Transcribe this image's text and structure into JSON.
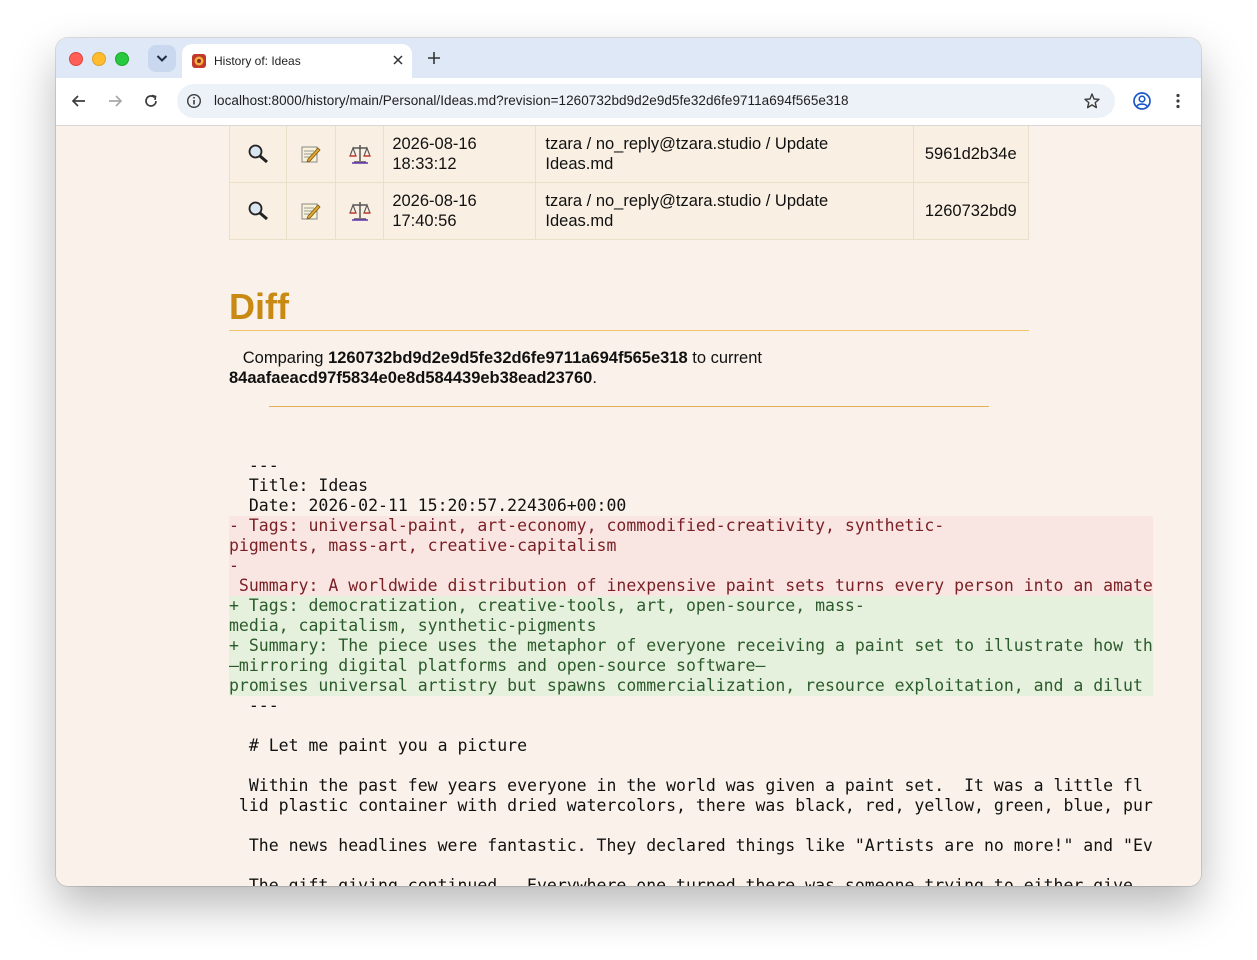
{
  "browser": {
    "tab_title": "History of: Ideas",
    "url": "localhost:8000/history/main/Personal/Ideas.md?revision=1260732bd9d2e9d5fe32d6fe9711a694f565e318"
  },
  "history": {
    "rows": [
      {
        "date": "2026-08-16",
        "time": "18:33:12",
        "msg1": "tzara / no_reply@tzara.studio / Update",
        "msg2": "Ideas.md",
        "hash": "5961d2b34e"
      },
      {
        "date": "2026-08-16",
        "time": "17:40:56",
        "msg1": "tzara / no_reply@tzara.studio / Update",
        "msg2": "Ideas.md",
        "hash": "1260732bd9"
      }
    ]
  },
  "diff": {
    "heading": "Diff",
    "comparing_prefix": "Comparing ",
    "from_rev": "1260732bd9d2e9d5fe32d6fe9711a694f565e318",
    "to_text": " to current",
    "to_rev": "84aafaeacd97f5834e0e8d584439eb38ead23760",
    "period": ".",
    "lines": [
      "  ---",
      "  Title: Ideas",
      "  Date: 2026-02-11 15:20:57.224306+00:00",
      "- Tags: universal-paint, art-economy, commodified-creativity, synthetic-",
      "pigments, mass-art, creative-capitalism",
      "-",
      " Summary: A worldwide distribution of inexpensive paint sets turns every person into an amate",
      "+ Tags: democratization, creative-tools, art, open-source, mass-",
      "media, capitalism, synthetic-pigments",
      "+ Summary: The piece uses the metaphor of everyone receiving a paint set to illustrate how th",
      "—mirroring digital platforms and open-source software—",
      "promises universal artistry but spawns commercialization, resource exploitation, and a dilut",
      "  ---",
      "",
      "  # Let me paint you a picture",
      "",
      "  Within the past few years everyone in the world was given a paint set.  It was a little fl",
      " lid plastic container with dried watercolors, there was black, red, yellow, green, blue, pur",
      "",
      "  The news headlines were fantastic. They declared things like \"Artists are no more!\" and \"Ev",
      "",
      "  The gift giving continued.  Everywhere one turned there was someone trying to either give"
    ],
    "line_kinds": [
      "ctx",
      "ctx",
      "ctx",
      "del",
      "del",
      "del",
      "del",
      "add",
      "add",
      "add",
      "add",
      "add",
      "ctx",
      "ctx",
      "ctx",
      "ctx",
      "ctx",
      "ctx",
      "ctx",
      "ctx",
      "ctx",
      "ctx"
    ]
  }
}
